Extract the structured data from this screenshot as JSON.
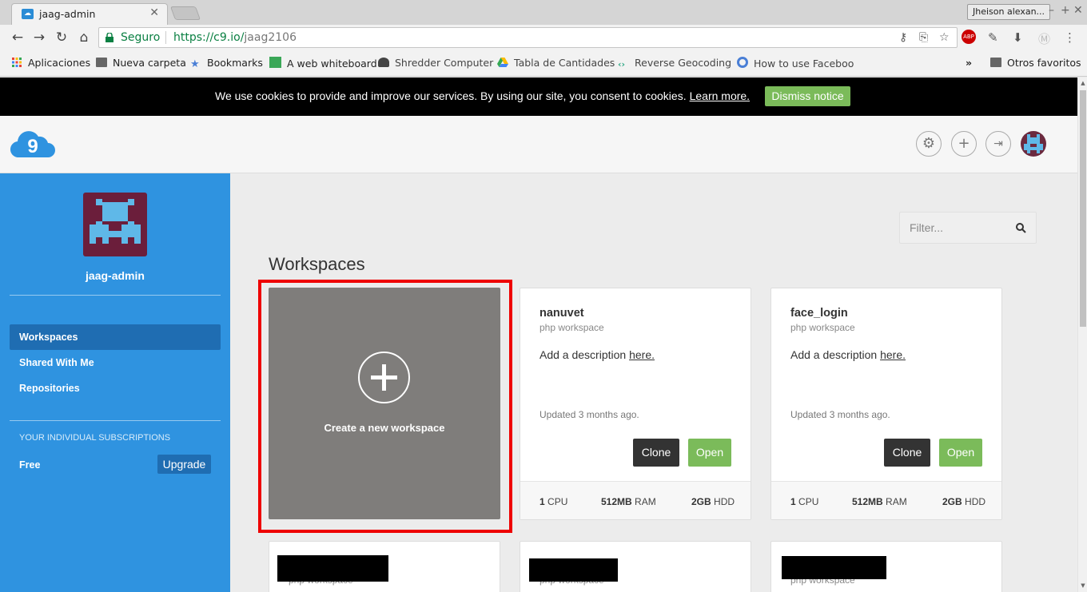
{
  "browser": {
    "tab_title": "jaag-admin",
    "profile_name": "Jheison alexan...",
    "secure_label": "Seguro",
    "url_scheme": "https://c9.io/",
    "url_path": "jaag2106"
  },
  "bookmarks": [
    {
      "label": "Aplicaciones",
      "icon": "apps-grid-icon"
    },
    {
      "label": "Nueva carpeta",
      "icon": "folder-icon"
    },
    {
      "label": "Bookmarks",
      "icon": "star-icon"
    },
    {
      "label": "A web whiteboard",
      "icon": "whiteboard-icon"
    },
    {
      "label": "Shredder Computer",
      "icon": "shredder-icon"
    },
    {
      "label": "Tabla de Cantidades",
      "icon": "drive-icon"
    },
    {
      "label": "Reverse Geocoding",
      "icon": "code-icon"
    },
    {
      "label": "How to use Faceboo",
      "icon": "globe-icon"
    }
  ],
  "bookmarks_overflow": "»",
  "other_bookmarks": "Otros favoritos",
  "cookie": {
    "text": "We use cookies to provide and improve our services. By using our site, you consent to cookies.",
    "link": "Learn more.",
    "dismiss": "Dismiss notice"
  },
  "sidebar": {
    "username": "jaag-admin",
    "nav": [
      {
        "label": "Workspaces",
        "active": true
      },
      {
        "label": "Shared With Me",
        "active": false
      },
      {
        "label": "Repositories",
        "active": false
      }
    ],
    "subscriptions_heading": "YOUR INDIVIDUAL SUBSCRIPTIONS",
    "plan": "Free",
    "upgrade": "Upgrade"
  },
  "main": {
    "filter_placeholder": "Filter...",
    "title": "Workspaces",
    "create_label": "Create a new workspace",
    "workspaces": [
      {
        "name": "nanuvet",
        "type": "php workspace",
        "desc_prefix": "Add a description ",
        "desc_link": "here.",
        "updated": "Updated 3 months ago.",
        "clone": "Clone",
        "open": "Open",
        "cpu": "1",
        "cpu_unit": "CPU",
        "ram": "512MB",
        "ram_unit": "RAM",
        "hdd": "2GB",
        "hdd_unit": "HDD"
      },
      {
        "name": "face_login",
        "type": "php workspace",
        "desc_prefix": "Add a description ",
        "desc_link": "here.",
        "updated": "Updated 3 months ago.",
        "clone": "Clone",
        "open": "Open",
        "cpu": "1",
        "cpu_unit": "CPU",
        "ram": "512MB",
        "ram_unit": "RAM",
        "hdd": "2GB",
        "hdd_unit": "HDD"
      }
    ],
    "second_row": [
      {
        "type": "php workspace"
      },
      {
        "type": "php workspace"
      },
      {
        "type": "php workspace"
      }
    ]
  },
  "colors": {
    "sidebar": "#2f93e0",
    "accent_green": "#7bbb5a",
    "highlight_red": "#ee0000"
  }
}
